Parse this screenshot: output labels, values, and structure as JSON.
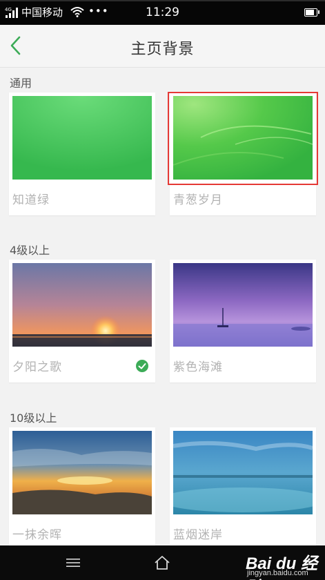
{
  "status_bar": {
    "network": "4G",
    "carrier": "中国移动",
    "dots": "•••",
    "time": "11:29",
    "battery_level": 0.85
  },
  "header": {
    "title": "主页背景",
    "back_icon": "chevron-left-icon",
    "accent_color": "#3cab57"
  },
  "sections": [
    {
      "title": "通用",
      "items": [
        {
          "name": "知道绿",
          "selected": false
        },
        {
          "name": "青葱岁月",
          "selected": false,
          "highlighted": true
        }
      ]
    },
    {
      "title": "4级以上",
      "items": [
        {
          "name": "夕阳之歌",
          "selected": true
        },
        {
          "name": "紫色海滩",
          "selected": false
        }
      ]
    },
    {
      "title": "10级以上",
      "items": [
        {
          "name": "一抹余晖",
          "selected": false
        },
        {
          "name": "蓝烟迷岸",
          "selected": false
        }
      ]
    }
  ],
  "nav_bar": {
    "menu_icon": "menu-icon",
    "home_icon": "home-icon"
  },
  "watermark": {
    "logo": "Bai du 经验",
    "url": "jingyan.baidu.com"
  },
  "colors": {
    "highlight_border": "#e53935",
    "check": "#3cab57"
  }
}
